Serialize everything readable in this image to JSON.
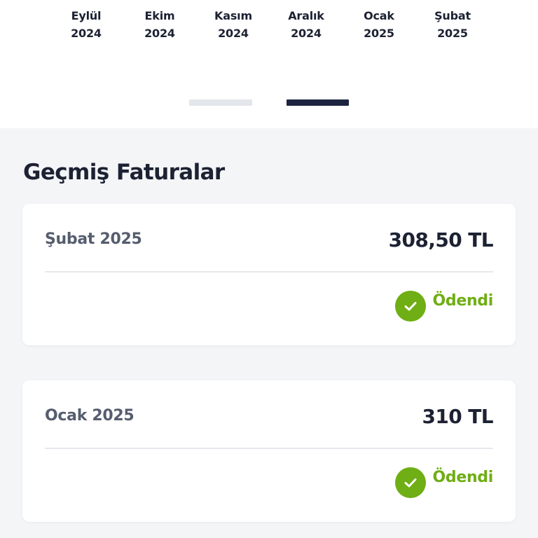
{
  "months": [
    {
      "name": "Eylül",
      "year": "2024"
    },
    {
      "name": "Ekim",
      "year": "2024"
    },
    {
      "name": "Kasım",
      "year": "2024"
    },
    {
      "name": "Aralık",
      "year": "2024"
    },
    {
      "name": "Ocak",
      "year": "2025"
    },
    {
      "name": "Şubat",
      "year": "2025"
    }
  ],
  "pager": {
    "active_index": 1,
    "count": 2
  },
  "history": {
    "title": "Geçmiş Faturalar",
    "invoices": [
      {
        "period": "Şubat 2025",
        "amount": "308,50 TL",
        "status": "Ödendi"
      },
      {
        "period": "Ocak 2025",
        "amount": "310 TL",
        "status": "Ödendi"
      }
    ]
  },
  "icons": {
    "status": "checkmark-icon"
  },
  "colors": {
    "text_primary": "#1c2233",
    "text_secondary": "#555d6e",
    "paid_green": "#6fae14",
    "pager_active": "#1c2440",
    "pager_inactive": "#e3e6ea",
    "page_background": "#f4f5f7"
  }
}
